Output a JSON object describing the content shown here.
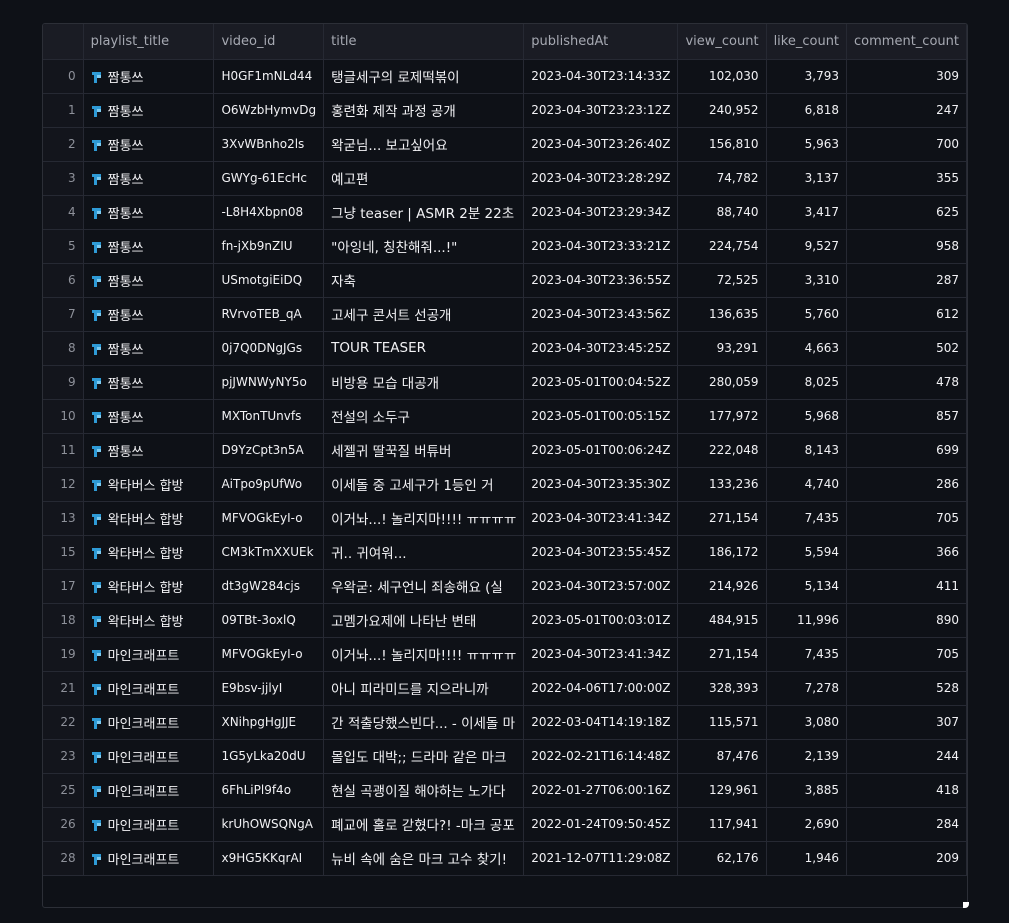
{
  "table": {
    "columns": {
      "index": "",
      "playlist_title": "playlist_title",
      "video_id": "video_id",
      "title": "title",
      "publishedAt": "publishedAt",
      "view_count": "view_count",
      "like_count": "like_count",
      "comment_count": "comment_count"
    },
    "rows": [
      {
        "index": "0",
        "playlist_title": "짬통쓰",
        "video_id": "H0GF1mNLd44",
        "title": "탱글세구의 로제떡볶이",
        "publishedAt": "2023-04-30T23:14:33Z",
        "view_count": "102,030",
        "like_count": "3,793",
        "comment_count": "309"
      },
      {
        "index": "1",
        "playlist_title": "짬통쓰",
        "video_id": "O6WzbHymvDg",
        "title": "홍련화 제작 과정 공개",
        "publishedAt": "2023-04-30T23:23:12Z",
        "view_count": "240,952",
        "like_count": "6,818",
        "comment_count": "247"
      },
      {
        "index": "2",
        "playlist_title": "짬통쓰",
        "video_id": "3XvWBnho2ls",
        "title": "왁굳님... 보고싶어요",
        "publishedAt": "2023-04-30T23:26:40Z",
        "view_count": "156,810",
        "like_count": "5,963",
        "comment_count": "700"
      },
      {
        "index": "3",
        "playlist_title": "짬통쓰",
        "video_id": "GWYg-61EcHc",
        "title": "예고편",
        "publishedAt": "2023-04-30T23:28:29Z",
        "view_count": "74,782",
        "like_count": "3,137",
        "comment_count": "355"
      },
      {
        "index": "4",
        "playlist_title": "짬통쓰",
        "video_id": "-L8H4Xbpn08",
        "title": "그냥 teaser | ASMR 2분 22초",
        "publishedAt": "2023-04-30T23:29:34Z",
        "view_count": "88,740",
        "like_count": "3,417",
        "comment_count": "625"
      },
      {
        "index": "5",
        "playlist_title": "짬통쓰",
        "video_id": "fn-jXb9nZIU",
        "title": "\"아잉네, 칭찬해줘...!\"",
        "publishedAt": "2023-04-30T23:33:21Z",
        "view_count": "224,754",
        "like_count": "9,527",
        "comment_count": "958"
      },
      {
        "index": "6",
        "playlist_title": "짬통쓰",
        "video_id": "USmotgiEiDQ",
        "title": "자축",
        "publishedAt": "2023-04-30T23:36:55Z",
        "view_count": "72,525",
        "like_count": "3,310",
        "comment_count": "287"
      },
      {
        "index": "7",
        "playlist_title": "짬통쓰",
        "video_id": "RVrvoTEB_qA",
        "title": "고세구 콘서트 선공개",
        "publishedAt": "2023-04-30T23:43:56Z",
        "view_count": "136,635",
        "like_count": "5,760",
        "comment_count": "612"
      },
      {
        "index": "8",
        "playlist_title": "짬통쓰",
        "video_id": "0j7Q0DNgJGs",
        "title": "TOUR TEASER",
        "publishedAt": "2023-04-30T23:45:25Z",
        "view_count": "93,291",
        "like_count": "4,663",
        "comment_count": "502"
      },
      {
        "index": "9",
        "playlist_title": "짬통쓰",
        "video_id": "pjJWNWyNY5o",
        "title": "비방용 모습 대공개",
        "publishedAt": "2023-05-01T00:04:52Z",
        "view_count": "280,059",
        "like_count": "8,025",
        "comment_count": "478"
      },
      {
        "index": "10",
        "playlist_title": "짬통쓰",
        "video_id": "MXTonTUnvfs",
        "title": "전설의 소두구",
        "publishedAt": "2023-05-01T00:05:15Z",
        "view_count": "177,972",
        "like_count": "5,968",
        "comment_count": "857"
      },
      {
        "index": "11",
        "playlist_title": "짬통쓰",
        "video_id": "D9YzCpt3n5A",
        "title": "세젤귀 딸꾹질 버튜버",
        "publishedAt": "2023-05-01T00:06:24Z",
        "view_count": "222,048",
        "like_count": "8,143",
        "comment_count": "699"
      },
      {
        "index": "12",
        "playlist_title": "왁타버스 합방",
        "video_id": "AiTpo9pUfWo",
        "title": "이세돌 중 고세구가 1등인 거",
        "publishedAt": "2023-04-30T23:35:30Z",
        "view_count": "133,236",
        "like_count": "4,740",
        "comment_count": "286"
      },
      {
        "index": "13",
        "playlist_title": "왁타버스 합방",
        "video_id": "MFVOGkEyI-o",
        "title": "이거놔...! 놀리지마!!!! ㅠㅠㅠㅠ",
        "publishedAt": "2023-04-30T23:41:34Z",
        "view_count": "271,154",
        "like_count": "7,435",
        "comment_count": "705"
      },
      {
        "index": "15",
        "playlist_title": "왁타버스 합방",
        "video_id": "CM3kTmXXUEk",
        "title": "귀.. 귀여워...",
        "publishedAt": "2023-04-30T23:55:45Z",
        "view_count": "186,172",
        "like_count": "5,594",
        "comment_count": "366"
      },
      {
        "index": "17",
        "playlist_title": "왁타버스 합방",
        "video_id": "dt3gW284cjs",
        "title": "우왁굳: 세구언니 죄송해요 (실",
        "publishedAt": "2023-04-30T23:57:00Z",
        "view_count": "214,926",
        "like_count": "5,134",
        "comment_count": "411"
      },
      {
        "index": "18",
        "playlist_title": "왁타버스 합방",
        "video_id": "09TBt-3oxlQ",
        "title": "고멤가요제에 나타난 변태",
        "publishedAt": "2023-05-01T00:03:01Z",
        "view_count": "484,915",
        "like_count": "11,996",
        "comment_count": "890"
      },
      {
        "index": "19",
        "playlist_title": "마인크래프트",
        "video_id": "MFVOGkEyI-o",
        "title": "이거놔...! 놀리지마!!!! ㅠㅠㅠㅠ",
        "publishedAt": "2023-04-30T23:41:34Z",
        "view_count": "271,154",
        "like_count": "7,435",
        "comment_count": "705"
      },
      {
        "index": "21",
        "playlist_title": "마인크래프트",
        "video_id": "E9bsv-jjlyI",
        "title": "아니 피라미드를 지으라니까",
        "publishedAt": "2022-04-06T17:00:00Z",
        "view_count": "328,393",
        "like_count": "7,278",
        "comment_count": "528"
      },
      {
        "index": "22",
        "playlist_title": "마인크래프트",
        "video_id": "XNihpgHgJJE",
        "title": "간 적출당했스빈다... - 이세돌 마",
        "publishedAt": "2022-03-04T14:19:18Z",
        "view_count": "115,571",
        "like_count": "3,080",
        "comment_count": "307"
      },
      {
        "index": "23",
        "playlist_title": "마인크래프트",
        "video_id": "1G5yLka20dU",
        "title": "몰입도 대박;; 드라마 같은 마크",
        "publishedAt": "2022-02-21T16:14:48Z",
        "view_count": "87,476",
        "like_count": "2,139",
        "comment_count": "244"
      },
      {
        "index": "25",
        "playlist_title": "마인크래프트",
        "video_id": "6FhLiPl9f4o",
        "title": "현실 곡괭이질 해야하는 노가다",
        "publishedAt": "2022-01-27T06:00:16Z",
        "view_count": "129,961",
        "like_count": "3,885",
        "comment_count": "418"
      },
      {
        "index": "26",
        "playlist_title": "마인크래프트",
        "video_id": "krUhOWSQNgA",
        "title": "폐교에 홀로 갇혔다?! -마크 공포",
        "publishedAt": "2022-01-24T09:50:45Z",
        "view_count": "117,941",
        "like_count": "2,690",
        "comment_count": "284"
      },
      {
        "index": "28",
        "playlist_title": "마인크래프트",
        "video_id": "x9HG5KKqrAI",
        "title": "뉴비 속에 숨은 마크 고수 찾기!",
        "publishedAt": "2021-12-07T11:29:08Z",
        "view_count": "62,176",
        "like_count": "1,946",
        "comment_count": "209"
      }
    ]
  },
  "colors": {
    "background": "#0e1117",
    "header_bg": "#1a1c24",
    "grid_line": "#262933",
    "text": "#f2f2f5",
    "header_text": "#a6a9b2",
    "icon_blue": "#2f9bd6"
  },
  "icons": {
    "playlist_icon": "youtube-playlist-emoji-icon"
  }
}
